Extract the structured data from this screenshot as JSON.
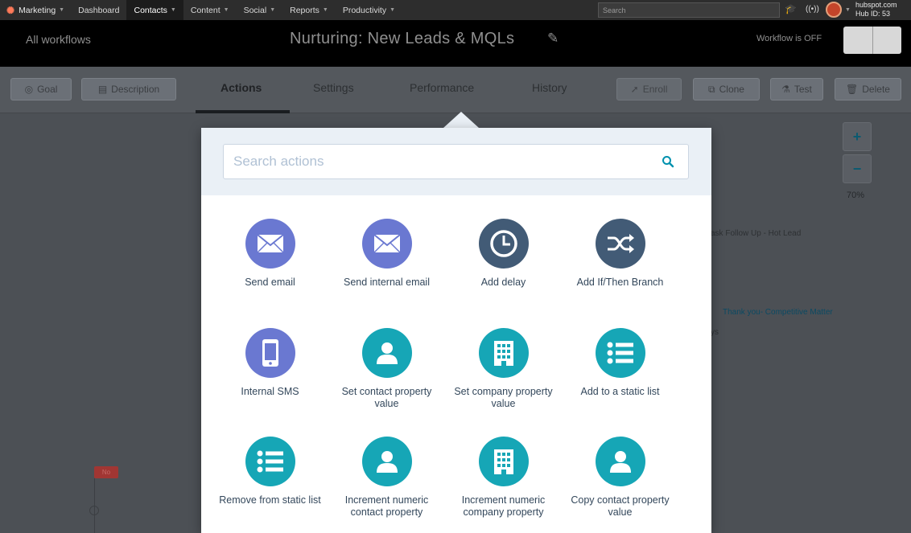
{
  "topnav": {
    "brand": "Marketing",
    "items": [
      {
        "label": "Dashboard",
        "caret": false,
        "active": false
      },
      {
        "label": "Contacts",
        "caret": true,
        "active": true
      },
      {
        "label": "Content",
        "caret": true,
        "active": false
      },
      {
        "label": "Social",
        "caret": true,
        "active": false
      },
      {
        "label": "Reports",
        "caret": true,
        "active": false
      },
      {
        "label": "Productivity",
        "caret": true,
        "active": false
      }
    ],
    "search_placeholder": "Search",
    "hub_domain": "hubspot.com",
    "hub_id": "Hub ID: 53"
  },
  "workflow": {
    "back_label": "All workflows",
    "title": "Nurturing: New Leads & MQLs",
    "status": "Workflow is OFF"
  },
  "toolbar": {
    "goal": "Goal",
    "description": "Description",
    "tabs": [
      "Actions",
      "Settings",
      "Performance",
      "History"
    ],
    "enroll": "Enroll",
    "clone": "Clone",
    "test": "Test",
    "delete": "Delete"
  },
  "canvas": {
    "zoom": "70%",
    "bg_text_1": "ask Follow Up - Hot Lead",
    "bg_text_2": "Thank you- Competitive Matter",
    "bg_text_3": "ys",
    "no_badge": "No"
  },
  "popover": {
    "search_placeholder": "Search actions",
    "actions": [
      {
        "label": "Send email",
        "icon": "envelope-icon",
        "color": "#6a78d1"
      },
      {
        "label": "Send internal email",
        "icon": "envelope-icon",
        "color": "#6a78d1"
      },
      {
        "label": "Add delay",
        "icon": "clock-icon",
        "color": "#425b76"
      },
      {
        "label": "Add If/Then Branch",
        "icon": "shuffle-icon",
        "color": "#425b76"
      },
      {
        "label": "Internal SMS",
        "icon": "phone-icon",
        "color": "#6a78d1"
      },
      {
        "label": "Set contact property value",
        "icon": "person-icon",
        "color": "#16a6b6"
      },
      {
        "label": "Set company property value",
        "icon": "building-icon",
        "color": "#16a6b6"
      },
      {
        "label": "Add to a static list",
        "icon": "list-icon",
        "color": "#16a6b6"
      },
      {
        "label": "Remove from static list",
        "icon": "list-icon",
        "color": "#16a6b6"
      },
      {
        "label": "Increment numeric contact property",
        "icon": "person-icon",
        "color": "#16a6b6"
      },
      {
        "label": "Increment numeric company property",
        "icon": "building-icon",
        "color": "#16a6b6"
      },
      {
        "label": "Copy contact property value",
        "icon": "person-icon",
        "color": "#16a6b6"
      }
    ]
  }
}
